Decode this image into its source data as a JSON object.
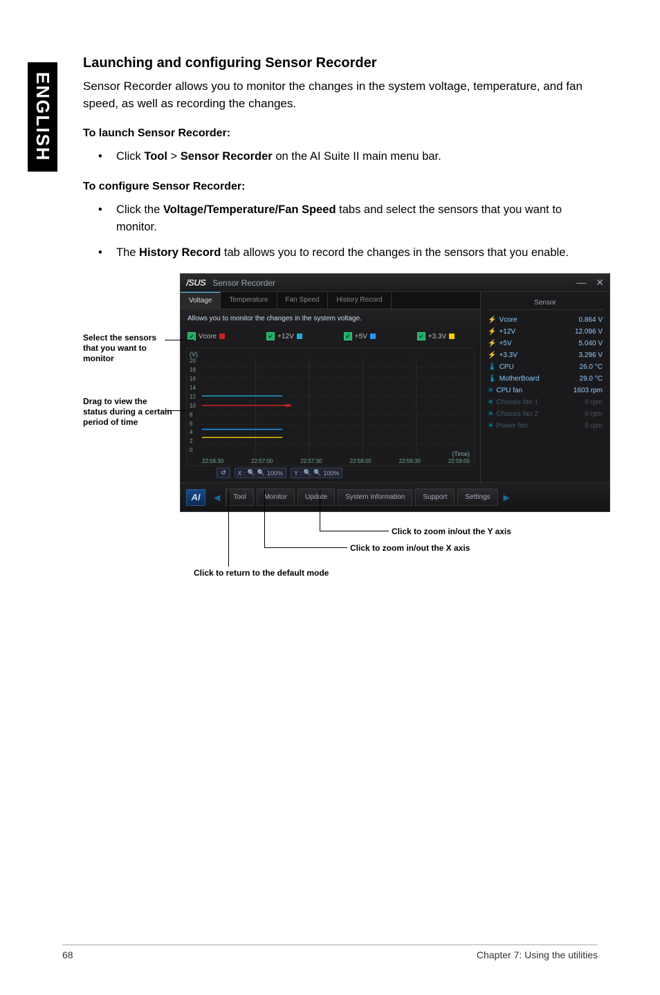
{
  "lang_tab": "ENGLISH",
  "heading": "Launching and configuring Sensor Recorder",
  "intro": "Sensor Recorder allows you to monitor the changes in the system voltage, temperature, and fan speed, as well as recording the changes.",
  "launch_heading": "To launch Sensor Recorder:",
  "launch_item_pre": "Click ",
  "launch_item_b1": "Tool",
  "launch_item_mid": " > ",
  "launch_item_b2": "Sensor Recorder",
  "launch_item_post": " on the AI Suite II main menu bar.",
  "configure_heading": "To configure Sensor Recorder:",
  "cfg_item1_pre": "Click the ",
  "cfg_item1_b": "Voltage/Temperature/Fan Speed",
  "cfg_item1_post": " tabs and select the sensors that you want to monitor.",
  "cfg_item2_pre": "The ",
  "cfg_item2_b": "History Record",
  "cfg_item2_post": " tab allows you to record the changes in the sensors that you enable.",
  "callout_select": "Select the sensors that you want to monitor",
  "callout_drag": "Drag to view the status during a certain period of time",
  "callout_yzoom": "Click to zoom in/out the Y axis",
  "callout_xzoom": "Click to zoom in/out the X axis",
  "callout_reset": "Click to return to the default mode",
  "app": {
    "brand": "/SUS",
    "name": "Sensor Recorder",
    "win_min": "—",
    "win_close": "✕",
    "tabs": [
      "Voltage",
      "Temperature",
      "Fan Speed",
      "History Record"
    ],
    "desc": "Allows you to monitor the changes in the system voltage.",
    "checks": [
      {
        "label": "Vcore",
        "color": "#c22"
      },
      {
        "label": "+12V",
        "color": "#2ad"
      },
      {
        "label": "+5V",
        "color": "#29f"
      },
      {
        "label": "+3.3V",
        "color": "#fc0"
      }
    ],
    "ylabel": "(V)",
    "tlabel": "(Time)",
    "zoom_x_label": "X :",
    "zoom_y_label": "Y :",
    "zoom_pct": "100%",
    "sensor_title": "Sensor",
    "sensors": [
      {
        "icon": "bolt",
        "name": "Vcore",
        "val": "0.864",
        "unit": "V",
        "dim": false
      },
      {
        "icon": "bolt",
        "name": "+12V",
        "val": "12.096",
        "unit": "V",
        "dim": false
      },
      {
        "icon": "bolt",
        "name": "+5V",
        "val": "5.040",
        "unit": "V",
        "dim": false
      },
      {
        "icon": "bolt",
        "name": "+3.3V",
        "val": "3.296",
        "unit": "V",
        "dim": false
      },
      {
        "icon": "temp",
        "name": "CPU",
        "val": "26.0",
        "unit": "°C",
        "dim": false
      },
      {
        "icon": "temp",
        "name": "MotherBoard",
        "val": "29.0",
        "unit": "°C",
        "dim": false
      },
      {
        "icon": "fan",
        "name": "CPU fan",
        "val": "1603",
        "unit": "rpm",
        "dim": false
      },
      {
        "icon": "fan",
        "name": "Chassis fan 1",
        "val": "0",
        "unit": "rpm",
        "dim": true
      },
      {
        "icon": "fan",
        "name": "Chassis fan 2",
        "val": "0",
        "unit": "rpm",
        "dim": true
      },
      {
        "icon": "fan",
        "name": "Power fan",
        "val": "0",
        "unit": "rpm",
        "dim": true
      }
    ],
    "footer": [
      "Tool",
      "Monitor",
      "Update",
      "System Information",
      "Support",
      "Settings"
    ]
  },
  "chart_data": {
    "type": "line",
    "title": "",
    "xlabel": "(Time)",
    "ylabel": "(V)",
    "ylim": [
      0,
      20
    ],
    "yticks": [
      20,
      18,
      16,
      14,
      12,
      10,
      8,
      6,
      4,
      2,
      0
    ],
    "x": [
      "22:56:30",
      "22:57:00",
      "22:57:30",
      "22:58:00",
      "22:58:30",
      "22:59:00"
    ],
    "series": [
      {
        "name": "Vcore",
        "color": "#c22",
        "values": [
          10,
          10,
          10,
          10,
          10,
          10
        ]
      },
      {
        "name": "+12V",
        "color": "#2ad",
        "values": [
          12,
          12,
          12,
          12,
          12,
          12
        ]
      },
      {
        "name": "+5V",
        "color": "#29f",
        "values": [
          5,
          5,
          5,
          5,
          5,
          5
        ]
      },
      {
        "name": "+3.3V",
        "color": "#fc0",
        "values": [
          3.3,
          3.3,
          3.3,
          3.3,
          3.3,
          3.3
        ]
      }
    ]
  },
  "page_num": "68",
  "chapter": "Chapter 7: Using the utilities"
}
